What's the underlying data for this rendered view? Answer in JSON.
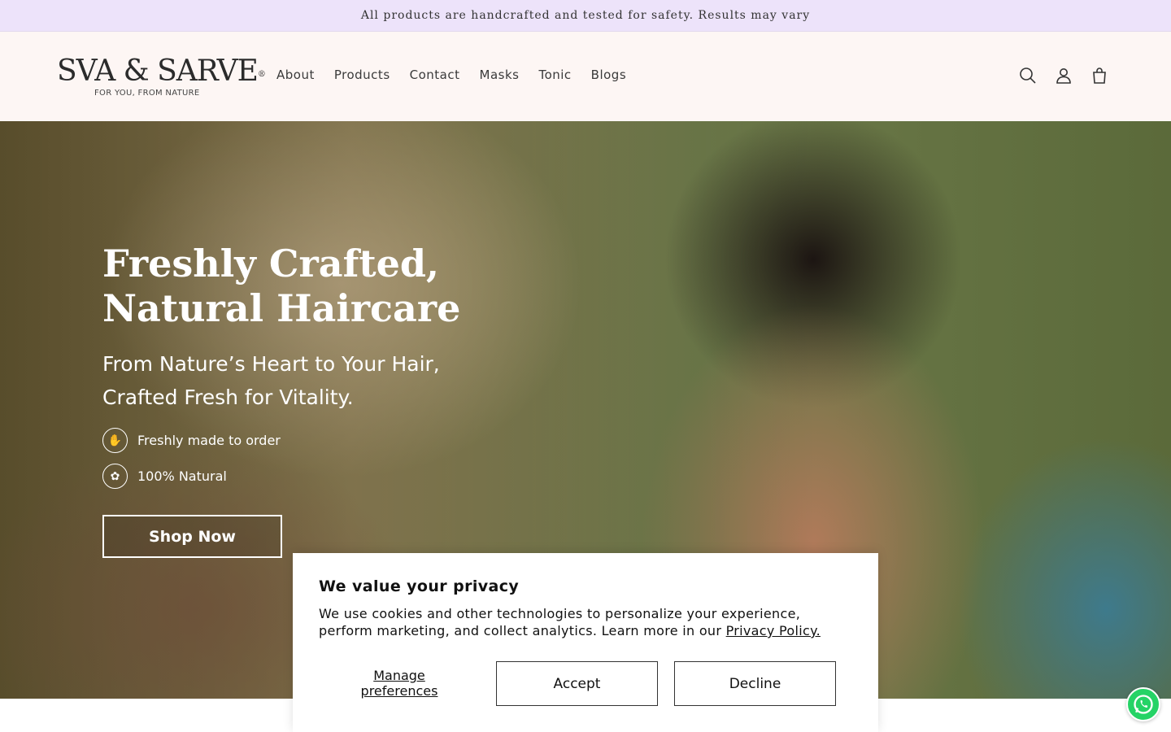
{
  "announcement": {
    "text": "All products are handcrafted and tested for safety. Results may vary"
  },
  "header": {
    "logo": {
      "main": "SVA & SARVE",
      "registered": "®",
      "tagline": "FOR YOU, FROM NATURE"
    },
    "nav": [
      {
        "label": "About"
      },
      {
        "label": "Products"
      },
      {
        "label": "Contact"
      },
      {
        "label": "Masks"
      },
      {
        "label": "Tonic"
      },
      {
        "label": "Blogs"
      }
    ],
    "icons": [
      "search-icon",
      "account-icon",
      "cart-icon"
    ]
  },
  "hero": {
    "title_line1": "Freshly Crafted,",
    "title_line2": "Natural Haircare",
    "subtitle_line1": "From Nature’s Heart to Your Hair,",
    "subtitle_line2": "Crafted Fresh for Vitality.",
    "features": [
      {
        "label": "Freshly made to order",
        "icon": "hand-leaf-icon"
      },
      {
        "label": "100% Natural",
        "icon": "lotus-icon"
      }
    ],
    "cta_label": "Shop Now"
  },
  "consent": {
    "title": "We value your privacy",
    "body_line1": "We use cookies and other technologies to personalize your experience,",
    "body_line2": "perform marketing, and collect analytics. Learn more in our",
    "privacy_link": "Privacy Policy.",
    "manage_line1": "Manage",
    "manage_line2": "preferences",
    "accept_label": "Accept",
    "decline_label": "Decline"
  },
  "colors": {
    "announcement_bg": "#ede3fa",
    "header_bg": "#fdf6f4",
    "whatsapp": "#25d366"
  }
}
